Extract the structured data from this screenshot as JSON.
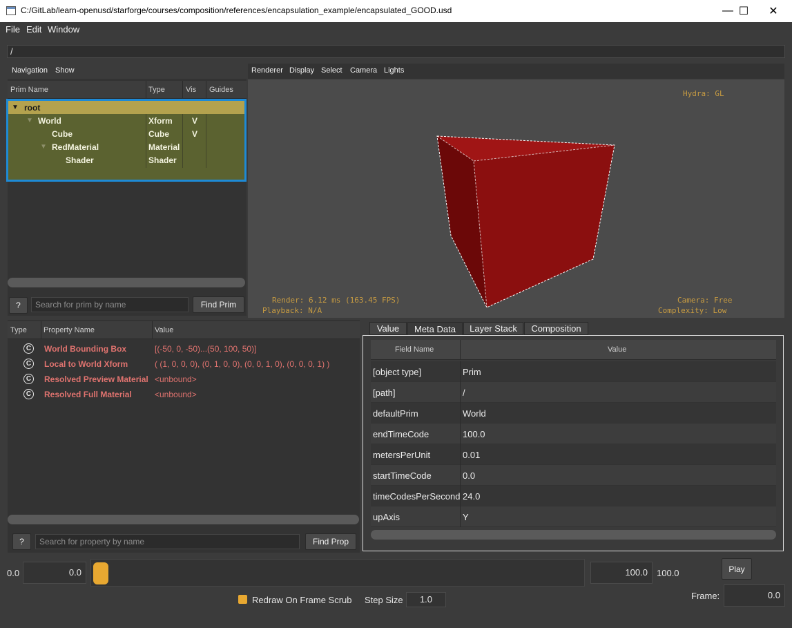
{
  "window": {
    "title": "C:/GitLab/learn-openusd/starforge/courses/composition/references/encapsulation_example/encapsulated_GOOD.usd",
    "minimize_icon": "minimize-icon",
    "maximize_icon": "maximize-icon",
    "close_icon": "close-icon"
  },
  "menu": {
    "file": "File",
    "edit": "Edit",
    "window": "Window"
  },
  "path": "/",
  "nav": {
    "menu": {
      "navigation": "Navigation",
      "show": "Show"
    },
    "columns": {
      "prim_name": "Prim Name",
      "type": "Type",
      "vis": "Vis",
      "guides": "Guides"
    },
    "rows": [
      {
        "name": "root",
        "type": "",
        "vis": ""
      },
      {
        "name": "World",
        "type": "Xform",
        "vis": "V"
      },
      {
        "name": "Cube",
        "type": "Cube",
        "vis": "V"
      },
      {
        "name": "RedMaterial",
        "type": "Material",
        "vis": ""
      },
      {
        "name": "Shader",
        "type": "Shader",
        "vis": ""
      }
    ],
    "help_label": "?",
    "search_placeholder": "Search for prim by name",
    "find_label": "Find Prim"
  },
  "viewport": {
    "menu": {
      "renderer": "Renderer",
      "display": "Display",
      "select": "Select",
      "camera": "Camera",
      "lights": "Lights"
    },
    "hydra": "Hydra: GL",
    "render": "Render: 6.12 ms (163.45 FPS)",
    "playback": "Playback: N/A",
    "camera": "Camera: Free",
    "complexity": "Complexity: Low",
    "cube_color": "#8b0f0f"
  },
  "properties": {
    "columns": {
      "type": "Type",
      "name": "Property Name",
      "value": "Value"
    },
    "rows": [
      {
        "icon": "C",
        "name": "World Bounding Box",
        "value": "[(-50, 0, -50)...(50, 100, 50)]"
      },
      {
        "icon": "C",
        "name": "Local to World Xform",
        "value": "( (1, 0, 0, 0), (0, 1, 0, 0), (0, 0, 1, 0), (0, 0, 0, 1) )"
      },
      {
        "icon": "C",
        "name": "Resolved Preview Material",
        "value": "<unbound>"
      },
      {
        "icon": "C",
        "name": "Resolved Full Material",
        "value": "<unbound>"
      }
    ],
    "help_label": "?",
    "search_placeholder": "Search for property by name",
    "find_label": "Find Prop"
  },
  "tabs": {
    "value": "Value",
    "meta": "Meta Data",
    "layer": "Layer Stack",
    "composition": "Composition"
  },
  "metadata": {
    "columns": {
      "field": "Field Name",
      "value": "Value"
    },
    "rows": [
      {
        "k": "[object type]",
        "v": "Prim"
      },
      {
        "k": "[path]",
        "v": "/"
      },
      {
        "k": "defaultPrim",
        "v": "World"
      },
      {
        "k": "endTimeCode",
        "v": "100.0"
      },
      {
        "k": "metersPerUnit",
        "v": "0.01"
      },
      {
        "k": "startTimeCode",
        "v": "0.0"
      },
      {
        "k": "timeCodesPerSecond",
        "v": "24.0"
      },
      {
        "k": "upAxis",
        "v": "Y"
      }
    ]
  },
  "timeline": {
    "start_label": "0.0",
    "start_value": "0.0",
    "end_value": "100.0",
    "end_label": "100.0",
    "play_label": "Play",
    "frame_label": "Frame:",
    "frame_value": "0.0",
    "redraw_label": "Redraw On Frame Scrub",
    "step_label": "Step Size",
    "step_value": "1.0",
    "accent": "#e8a831"
  }
}
